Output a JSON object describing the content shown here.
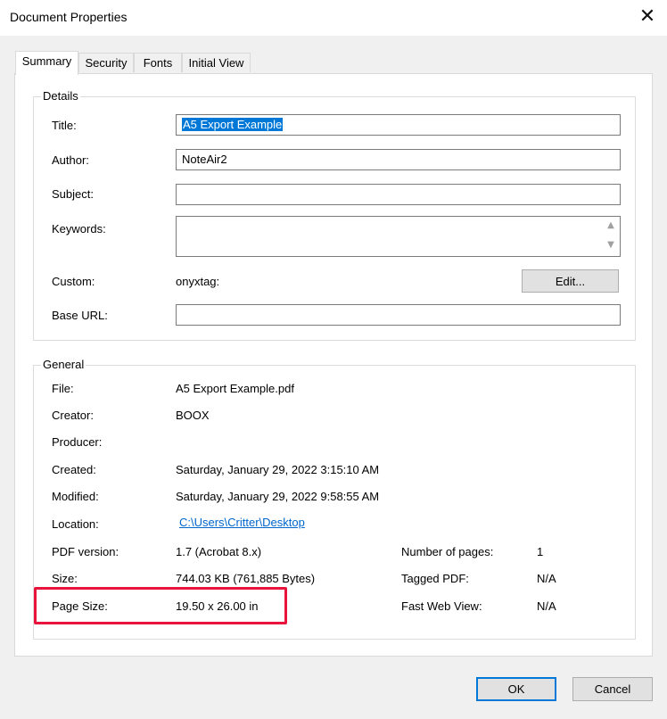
{
  "window": {
    "title": "Document Properties"
  },
  "tabs": [
    {
      "label": "Summary"
    },
    {
      "label": "Security"
    },
    {
      "label": "Fonts"
    },
    {
      "label": "Initial View"
    }
  ],
  "details": {
    "group_label": "Details",
    "title_label": "Title:",
    "title_value": "A5 Export Example",
    "author_label": "Author:",
    "author_value": "NoteAir2",
    "subject_label": "Subject:",
    "subject_value": "",
    "keywords_label": "Keywords:",
    "keywords_value": "",
    "custom_label": "Custom:",
    "custom_value": "onyxtag:",
    "edit_button": "Edit...",
    "base_url_label": "Base URL:",
    "base_url_value": ""
  },
  "general": {
    "group_label": "General",
    "file_label": "File:",
    "file_value": "A5 Export Example.pdf",
    "creator_label": "Creator:",
    "creator_value": "BOOX",
    "producer_label": "Producer:",
    "producer_value": "",
    "created_label": "Created:",
    "created_value": "Saturday, January 29, 2022 3:15:10 AM",
    "modified_label": "Modified:",
    "modified_value": "Saturday, January 29, 2022 9:58:55 AM",
    "location_label": "Location:",
    "location_value": "C:\\Users\\Critter\\Desktop",
    "pdf_version_label": "PDF version:",
    "pdf_version_value": "1.7 (Acrobat 8.x)",
    "size_label": "Size:",
    "size_value": "744.03 KB (761,885 Bytes)",
    "page_size_label": "Page Size:",
    "page_size_value": "19.50 x 26.00 in",
    "num_pages_label": "Number of pages:",
    "num_pages_value": "1",
    "tagged_pdf_label": "Tagged PDF:",
    "tagged_pdf_value": "N/A",
    "fast_web_label": "Fast Web View:",
    "fast_web_value": "N/A"
  },
  "footer": {
    "ok_label": "OK",
    "cancel_label": "Cancel"
  },
  "icons": {
    "close": "close-icon",
    "scroll_up": "chevron-up-icon",
    "scroll_down": "chevron-down-icon"
  },
  "colors": {
    "highlight": "#e8143c",
    "selection": "#0078d7",
    "link": "#0066cc",
    "default_button_border": "#0078d7"
  }
}
